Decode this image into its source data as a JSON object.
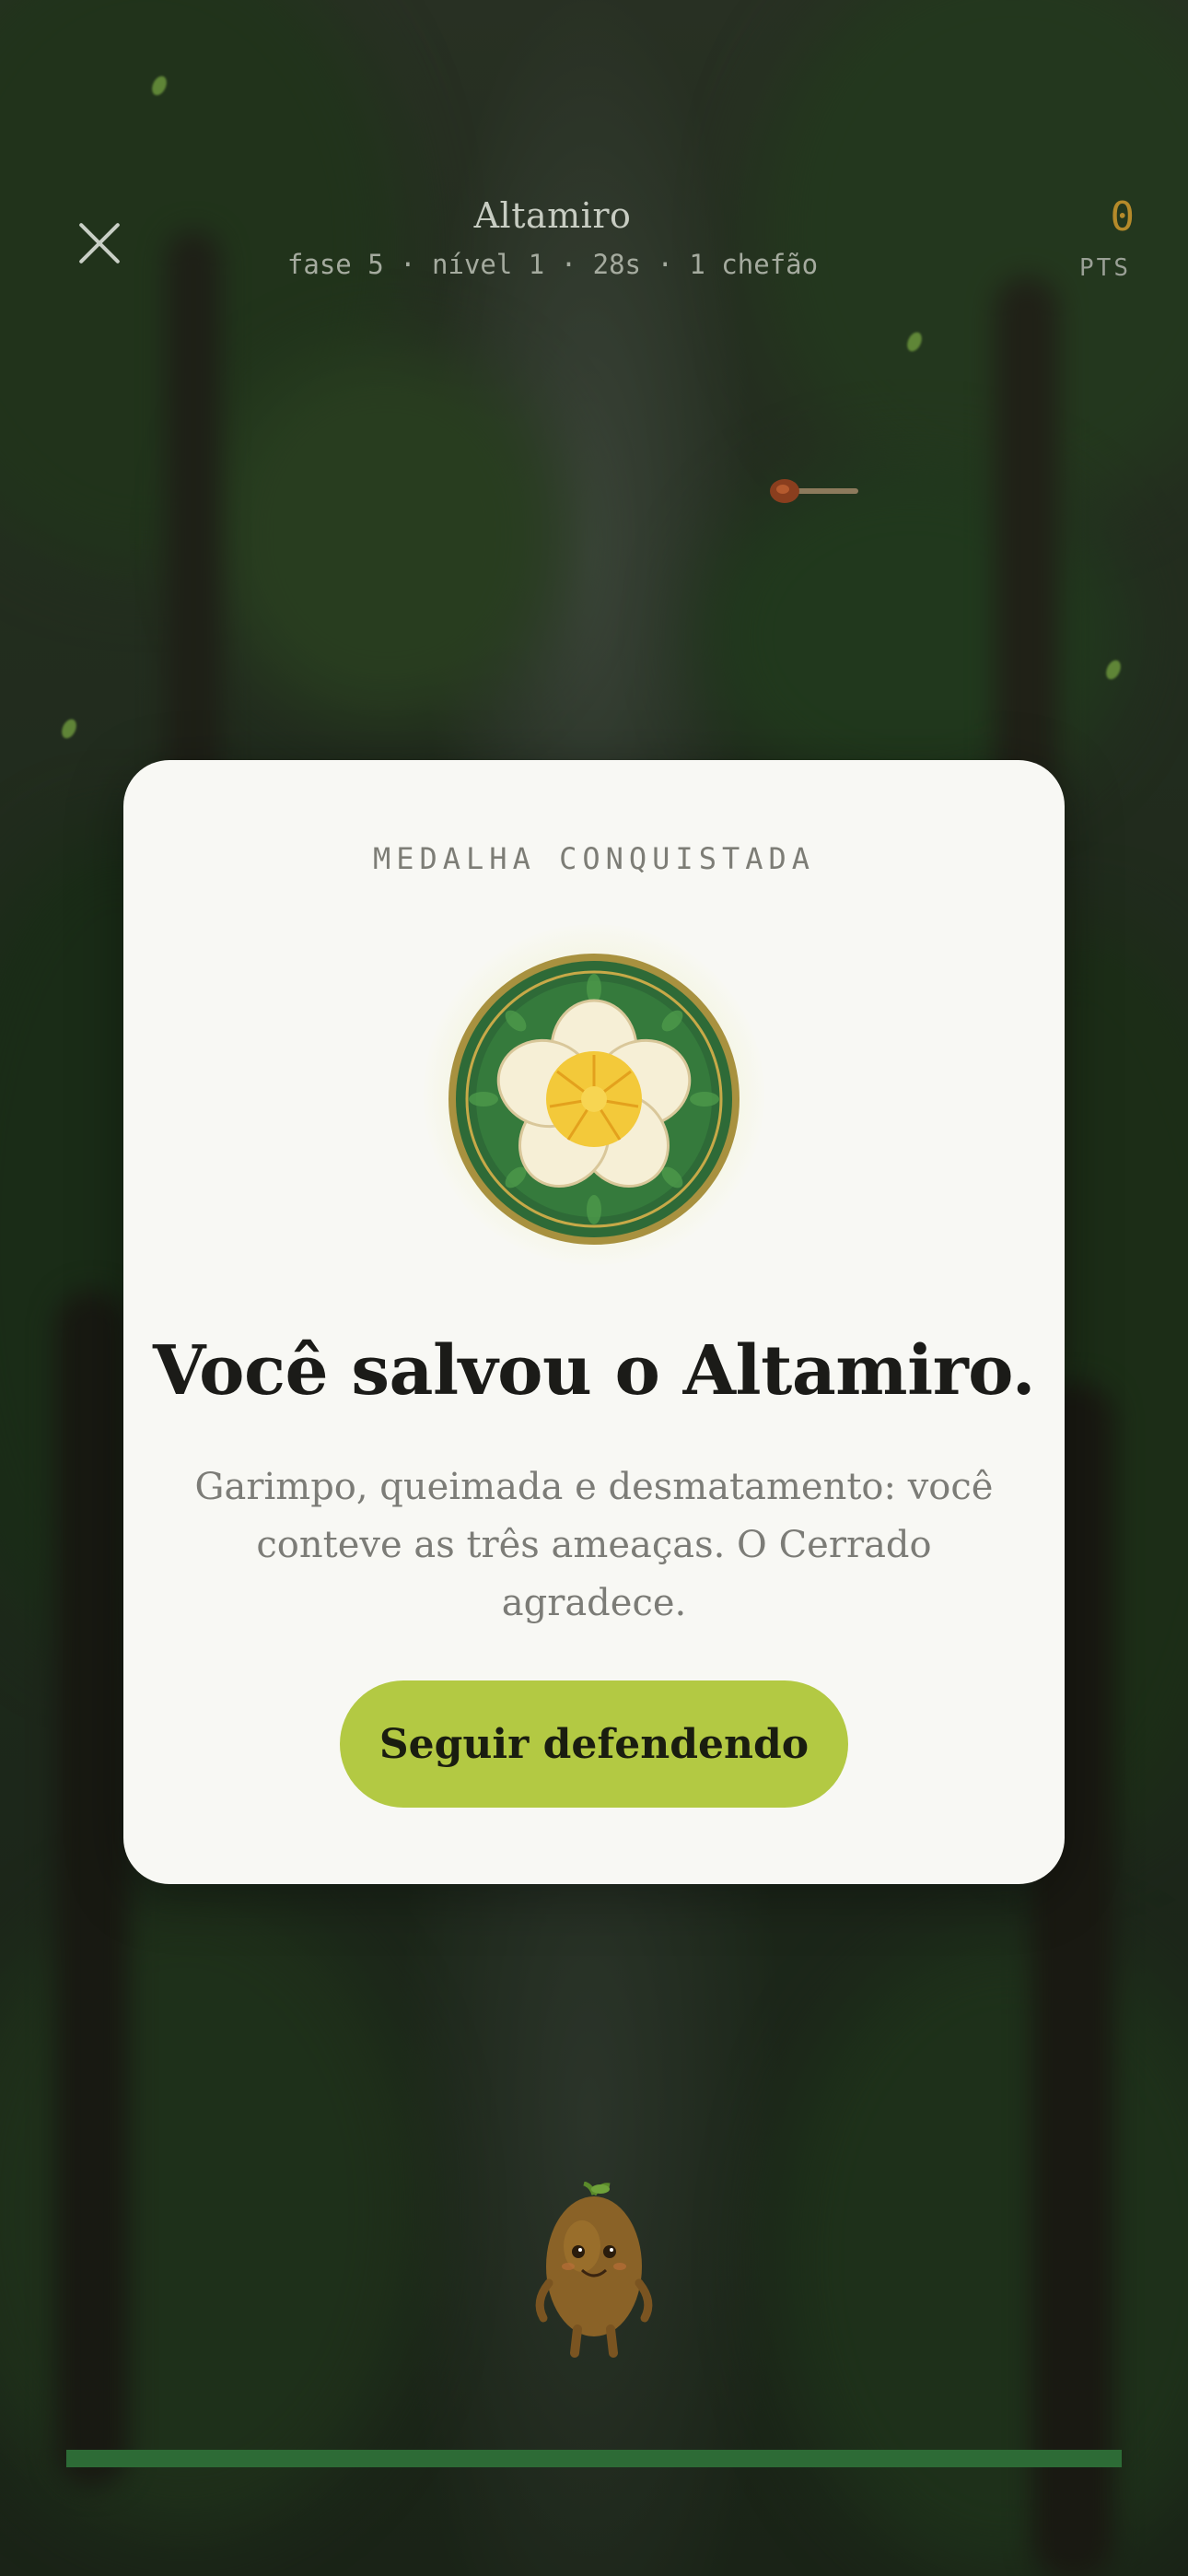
{
  "hud": {
    "close_icon": "close-icon",
    "title": "Altamiro",
    "subtitle": "fase 5 · nível 1 · 28s · 1 chefão",
    "score": "0",
    "score_label": "PTS",
    "score_color": "#b58a2a"
  },
  "modal": {
    "eyebrow": "MEDALHA CONQUISTADA",
    "medal_icon": "flower-medal-icon",
    "headline": "Você salvou o Altamiro.",
    "body": "Garimpo, queimada e desmatamento: você conteve as três ameaças. O Cerrado agradece.",
    "button_label": "Seguir defendendo",
    "button_color": "#b3c943"
  },
  "game": {
    "mascot_icon": "potato-mascot-icon",
    "projectile_icon": "seed-projectile-icon",
    "progress": 1.0,
    "progress_color": "#2d6b36"
  }
}
